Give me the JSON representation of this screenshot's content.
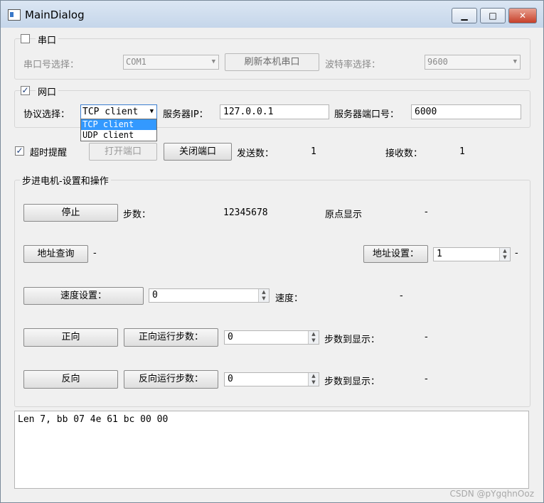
{
  "window": {
    "title": "MainDialog",
    "min_glyph": "▁",
    "max_glyph": "□",
    "close_glyph": "✕"
  },
  "serial": {
    "checkbox_label": "串口",
    "checked": false,
    "port_label": "串口号选择：",
    "port_value": "COM1",
    "refresh_button": "刷新本机串口",
    "baud_label": "波特率选择：",
    "baud_value": "9600"
  },
  "network": {
    "checkbox_label": "网口",
    "checked": true,
    "check_glyph": "✓",
    "protocol_label": "协议选择：",
    "protocol_value": "TCP client",
    "protocol_options": [
      "TCP client",
      "UDP client"
    ],
    "server_ip_label": "服务器IP：",
    "server_ip_value": "127.0.0.1",
    "server_port_label": "服务器端口号：",
    "server_port_value": "6000"
  },
  "connection": {
    "timeout_label": "超时提醒",
    "timeout_checked": true,
    "open_button": "打开端口",
    "close_button": "关闭端口",
    "send_label": "发送数：",
    "send_value": "1",
    "recv_label": "接收数：",
    "recv_value": "1"
  },
  "motor": {
    "group_title": "步进电机-设置和操作",
    "stop_button": "停止",
    "steps_label": "步数：",
    "steps_value": "12345678",
    "origin_label": "原点显示",
    "origin_value": "-",
    "addr_query_button": "地址查询",
    "addr_query_value": "-",
    "addr_set_button": "地址设置：",
    "addr_set_value": "1",
    "addr_set_result": "-",
    "speed_set_button": "速度设置：",
    "speed_set_value": "0",
    "speed_label": "速度：",
    "speed_value": "-",
    "forward_button": "正向",
    "forward_steps_button": "正向运行步数：",
    "forward_steps_value": "0",
    "forward_reach_label": "步数到显示：",
    "forward_reach_value": "-",
    "reverse_button": "反向",
    "reverse_steps_button": "反向运行步数：",
    "reverse_steps_value": "0",
    "reverse_reach_label": "步数到显示：",
    "reverse_reach_value": "-"
  },
  "log": {
    "text": "Len 7, bb 07 4e 61 bc 00 00"
  },
  "watermark": "CSDN @pYgqhnOoz"
}
